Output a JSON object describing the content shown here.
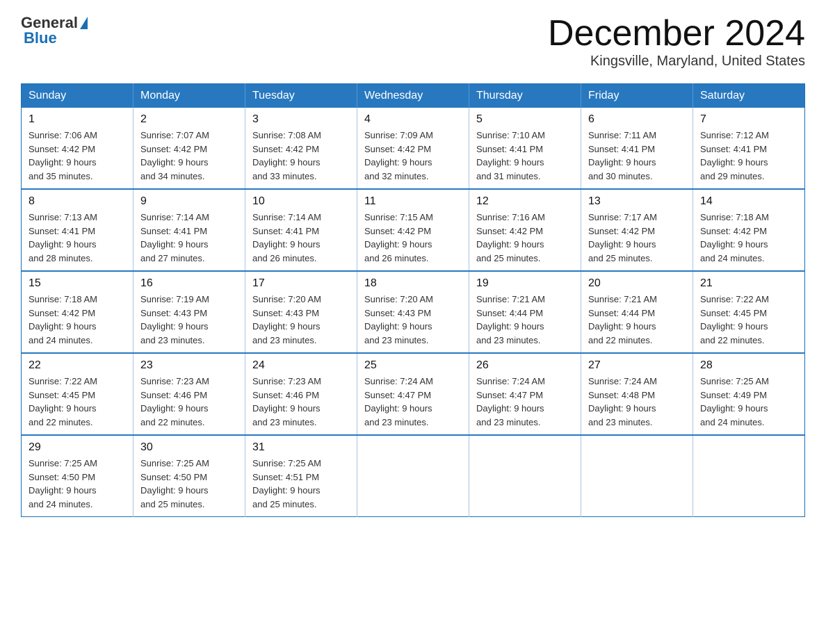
{
  "logo": {
    "text_general": "General",
    "text_blue": "Blue",
    "triangle": "▲"
  },
  "title": "December 2024",
  "location": "Kingsville, Maryland, United States",
  "days_of_week": [
    "Sunday",
    "Monday",
    "Tuesday",
    "Wednesday",
    "Thursday",
    "Friday",
    "Saturday"
  ],
  "weeks": [
    [
      {
        "day": "1",
        "sunrise": "7:06 AM",
        "sunset": "4:42 PM",
        "daylight": "9 hours and 35 minutes."
      },
      {
        "day": "2",
        "sunrise": "7:07 AM",
        "sunset": "4:42 PM",
        "daylight": "9 hours and 34 minutes."
      },
      {
        "day": "3",
        "sunrise": "7:08 AM",
        "sunset": "4:42 PM",
        "daylight": "9 hours and 33 minutes."
      },
      {
        "day": "4",
        "sunrise": "7:09 AM",
        "sunset": "4:42 PM",
        "daylight": "9 hours and 32 minutes."
      },
      {
        "day": "5",
        "sunrise": "7:10 AM",
        "sunset": "4:41 PM",
        "daylight": "9 hours and 31 minutes."
      },
      {
        "day": "6",
        "sunrise": "7:11 AM",
        "sunset": "4:41 PM",
        "daylight": "9 hours and 30 minutes."
      },
      {
        "day": "7",
        "sunrise": "7:12 AM",
        "sunset": "4:41 PM",
        "daylight": "9 hours and 29 minutes."
      }
    ],
    [
      {
        "day": "8",
        "sunrise": "7:13 AM",
        "sunset": "4:41 PM",
        "daylight": "9 hours and 28 minutes."
      },
      {
        "day": "9",
        "sunrise": "7:14 AM",
        "sunset": "4:41 PM",
        "daylight": "9 hours and 27 minutes."
      },
      {
        "day": "10",
        "sunrise": "7:14 AM",
        "sunset": "4:41 PM",
        "daylight": "9 hours and 26 minutes."
      },
      {
        "day": "11",
        "sunrise": "7:15 AM",
        "sunset": "4:42 PM",
        "daylight": "9 hours and 26 minutes."
      },
      {
        "day": "12",
        "sunrise": "7:16 AM",
        "sunset": "4:42 PM",
        "daylight": "9 hours and 25 minutes."
      },
      {
        "day": "13",
        "sunrise": "7:17 AM",
        "sunset": "4:42 PM",
        "daylight": "9 hours and 25 minutes."
      },
      {
        "day": "14",
        "sunrise": "7:18 AM",
        "sunset": "4:42 PM",
        "daylight": "9 hours and 24 minutes."
      }
    ],
    [
      {
        "day": "15",
        "sunrise": "7:18 AM",
        "sunset": "4:42 PM",
        "daylight": "9 hours and 24 minutes."
      },
      {
        "day": "16",
        "sunrise": "7:19 AM",
        "sunset": "4:43 PM",
        "daylight": "9 hours and 23 minutes."
      },
      {
        "day": "17",
        "sunrise": "7:20 AM",
        "sunset": "4:43 PM",
        "daylight": "9 hours and 23 minutes."
      },
      {
        "day": "18",
        "sunrise": "7:20 AM",
        "sunset": "4:43 PM",
        "daylight": "9 hours and 23 minutes."
      },
      {
        "day": "19",
        "sunrise": "7:21 AM",
        "sunset": "4:44 PM",
        "daylight": "9 hours and 23 minutes."
      },
      {
        "day": "20",
        "sunrise": "7:21 AM",
        "sunset": "4:44 PM",
        "daylight": "9 hours and 22 minutes."
      },
      {
        "day": "21",
        "sunrise": "7:22 AM",
        "sunset": "4:45 PM",
        "daylight": "9 hours and 22 minutes."
      }
    ],
    [
      {
        "day": "22",
        "sunrise": "7:22 AM",
        "sunset": "4:45 PM",
        "daylight": "9 hours and 22 minutes."
      },
      {
        "day": "23",
        "sunrise": "7:23 AM",
        "sunset": "4:46 PM",
        "daylight": "9 hours and 22 minutes."
      },
      {
        "day": "24",
        "sunrise": "7:23 AM",
        "sunset": "4:46 PM",
        "daylight": "9 hours and 23 minutes."
      },
      {
        "day": "25",
        "sunrise": "7:24 AM",
        "sunset": "4:47 PM",
        "daylight": "9 hours and 23 minutes."
      },
      {
        "day": "26",
        "sunrise": "7:24 AM",
        "sunset": "4:47 PM",
        "daylight": "9 hours and 23 minutes."
      },
      {
        "day": "27",
        "sunrise": "7:24 AM",
        "sunset": "4:48 PM",
        "daylight": "9 hours and 23 minutes."
      },
      {
        "day": "28",
        "sunrise": "7:25 AM",
        "sunset": "4:49 PM",
        "daylight": "9 hours and 24 minutes."
      }
    ],
    [
      {
        "day": "29",
        "sunrise": "7:25 AM",
        "sunset": "4:50 PM",
        "daylight": "9 hours and 24 minutes."
      },
      {
        "day": "30",
        "sunrise": "7:25 AM",
        "sunset": "4:50 PM",
        "daylight": "9 hours and 25 minutes."
      },
      {
        "day": "31",
        "sunrise": "7:25 AM",
        "sunset": "4:51 PM",
        "daylight": "9 hours and 25 minutes."
      },
      null,
      null,
      null,
      null
    ]
  ],
  "labels": {
    "sunrise": "Sunrise:",
    "sunset": "Sunset:",
    "daylight": "Daylight:"
  }
}
